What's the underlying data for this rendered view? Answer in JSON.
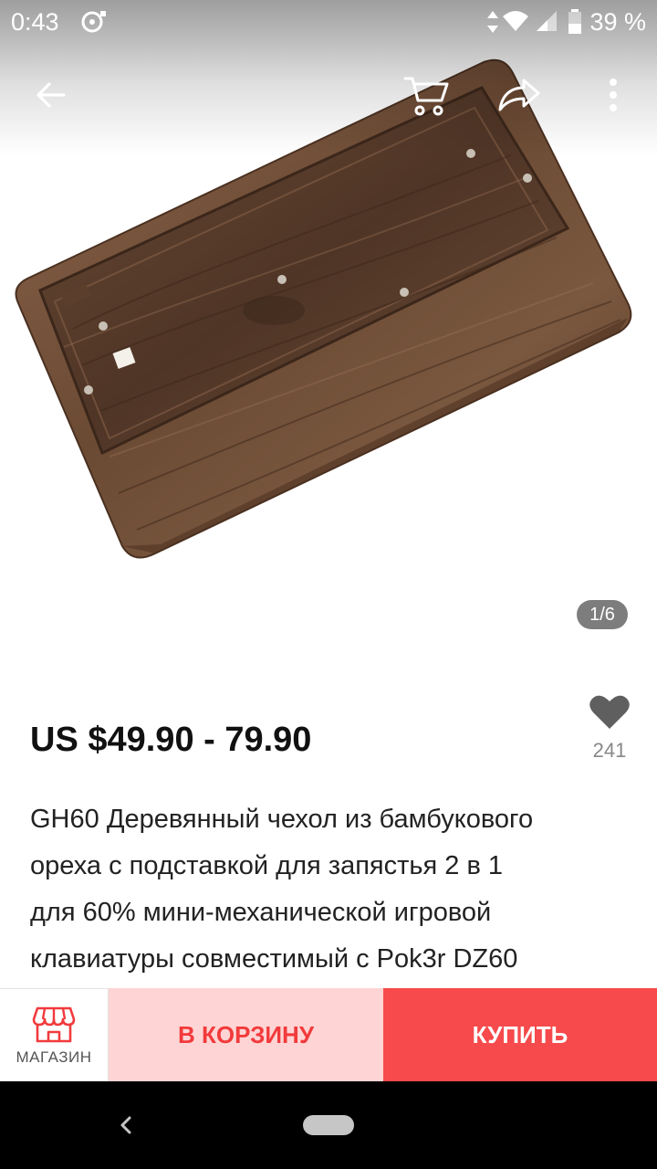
{
  "status_bar": {
    "time": "0:43",
    "battery_percent": "39 %"
  },
  "gallery": {
    "page_indicator": "1/6"
  },
  "product": {
    "price": "US $49.90 - 79.90",
    "wishlist_count": "241",
    "title_lines": [
      "GH60 Деревянный чехол из бамбукового",
      "ореха с подставкой для запястья 2 в 1",
      "для 60% мини-механической игровой",
      "клавиатуры совместимый с Pok3r DZ60"
    ]
  },
  "action_bar": {
    "store_label": "МАГАЗИН",
    "cart_label": "В КОРЗИНУ",
    "buy_label": "КУПИТЬ"
  },
  "icons": {
    "back": "arrow-left-icon",
    "cart": "cart-icon",
    "share": "share-icon",
    "more": "more-vertical-icon",
    "wishlist": "heart-icon",
    "store": "store-icon"
  },
  "colors": {
    "accent": "#f64a4c",
    "cart_bg": "#fed5d4",
    "cart_text": "#f23a3c",
    "wood_dark": "#5a3b27",
    "wood_light": "#8a634a"
  }
}
